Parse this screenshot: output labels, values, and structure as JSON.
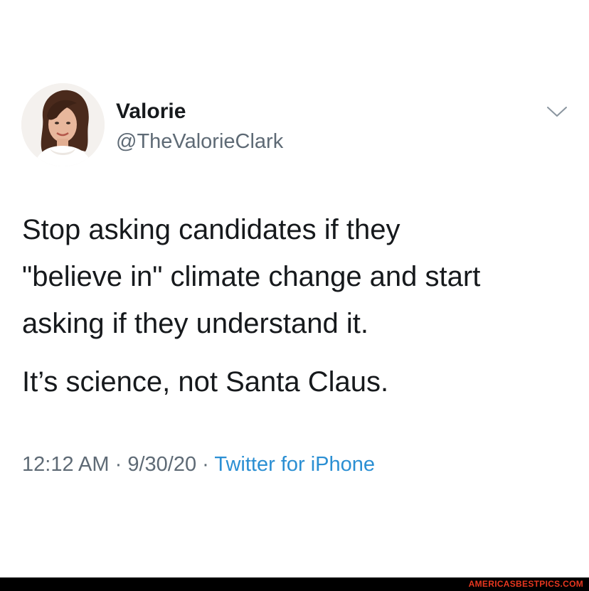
{
  "tweet": {
    "author": {
      "display_name": "Valorie",
      "handle": "@TheValorieClark",
      "avatar_icon": "profile-photo"
    },
    "menu_icon": "chevron-down-icon",
    "text_paragraphs": [
      [
        "Stop asking candidates if they",
        "\"believe in\" climate change and start",
        "asking if they understand it."
      ],
      [
        "It’s science, not Santa Claus."
      ]
    ],
    "time": "12:12 AM",
    "date": "9/30/20",
    "separator": "·",
    "source": "Twitter for iPhone"
  },
  "watermark": {
    "text": "AMERICASBESTPICS.COM"
  },
  "colors": {
    "name": "#16191c",
    "secondary_text": "#5e6a75",
    "link": "#2b8fd3",
    "watermark": "#e8371f"
  }
}
